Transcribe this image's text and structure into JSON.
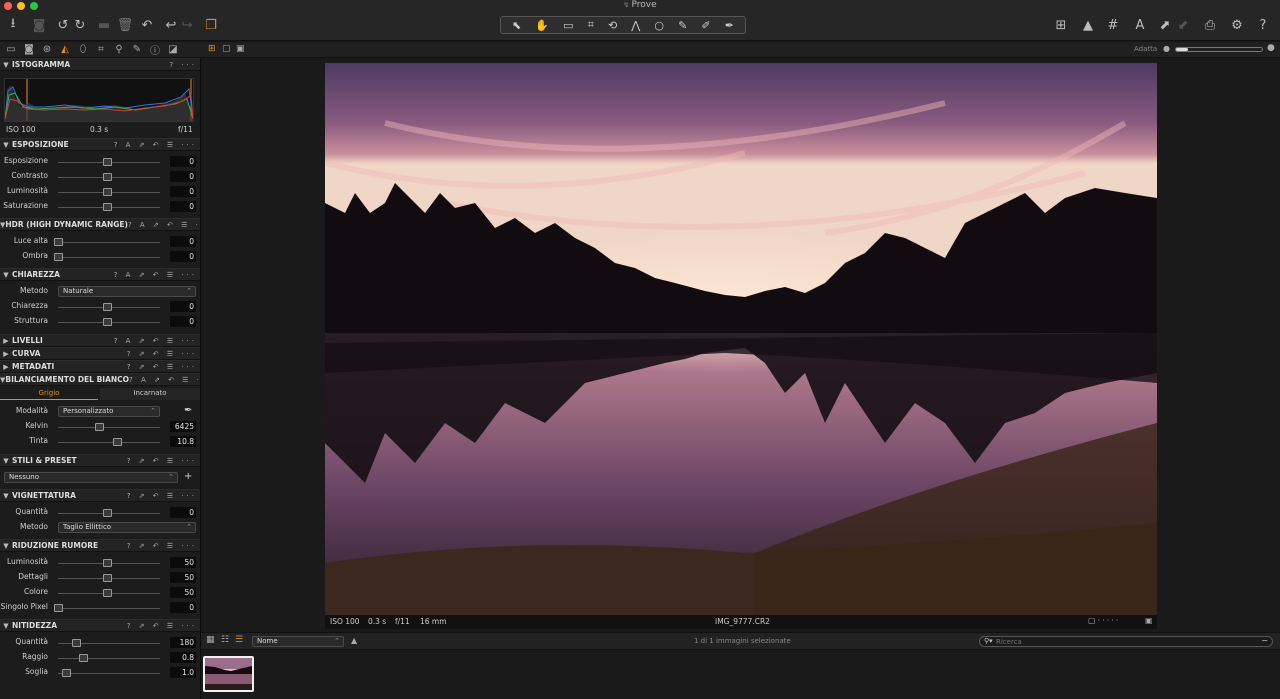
{
  "window": {
    "title": "Prove"
  },
  "colors": {
    "accent": "#e58a2b"
  },
  "histogram": {
    "iso": "ISO 100",
    "shutter": "0.3 s",
    "aperture": "f/11"
  },
  "sections": {
    "istogramma": "ISTOGRAMMA",
    "esposizione": "ESPOSIZIONE",
    "hdr": "HDR (HIGH DYNAMIC RANGE)",
    "chiarezza": "CHIAREZZA",
    "livelli": "LIVELLI",
    "curva": "CURVA",
    "metadati": "METADATI",
    "bilanciamento": "BILANCIAMENTO DEL BIANCO",
    "stili": "STILI & PRESET",
    "vignettatura": "VIGNETTATURA",
    "riduzione": "RIDUZIONE RUMORE",
    "nitidezza": "NITIDEZZA"
  },
  "esposizione": [
    {
      "label": "Esposizione",
      "value": "0",
      "pos": 0.5
    },
    {
      "label": "Contrasto",
      "value": "0",
      "pos": 0.5
    },
    {
      "label": "Luminosità",
      "value": "0",
      "pos": 0.5
    },
    {
      "label": "Saturazione",
      "value": "0",
      "pos": 0.5
    }
  ],
  "hdr": [
    {
      "label": "Luce alta",
      "value": "0",
      "pos": 0.0
    },
    {
      "label": "Ombra",
      "value": "0",
      "pos": 0.0
    }
  ],
  "chiarezza": {
    "metodo_label": "Metodo",
    "metodo_value": "Naturale",
    "sliders": [
      {
        "label": "Chiarezza",
        "value": "0",
        "pos": 0.5
      },
      {
        "label": "Struttura",
        "value": "0",
        "pos": 0.5
      }
    ]
  },
  "bilanciamento": {
    "tab_grigio": "Grigio",
    "tab_incarnato": "Incarnato",
    "modalita_label": "Modalità",
    "modalita_value": "Personalizzato",
    "sliders": [
      {
        "label": "Kelvin",
        "value": "6425",
        "pos": 0.42
      },
      {
        "label": "Tinta",
        "value": "10.8",
        "pos": 0.6
      }
    ]
  },
  "stili": {
    "value": "Nessuno"
  },
  "vignettatura": {
    "quantita_label": "Quantità",
    "quantita_value": "0",
    "quantita_pos": 0.5,
    "metodo_label": "Metodo",
    "metodo_value": "Taglio Ellittico"
  },
  "riduzione": [
    {
      "label": "Luminosità",
      "value": "50",
      "pos": 0.5
    },
    {
      "label": "Dettagli",
      "value": "50",
      "pos": 0.5
    },
    {
      "label": "Colore",
      "value": "50",
      "pos": 0.5
    },
    {
      "label": "Singolo Pixel",
      "value": "0",
      "pos": 0.0
    }
  ],
  "nitidezza": [
    {
      "label": "Quantità",
      "value": "180",
      "pos": 0.18
    },
    {
      "label": "Raggio",
      "value": "0.8",
      "pos": 0.26
    },
    {
      "label": "Soglia",
      "value": "1.0",
      "pos": 0.08
    }
  ],
  "viewer": {
    "fit_label": "Adatta",
    "iso": "ISO 100",
    "shutter": "0.3 s",
    "aperture": "f/11",
    "focal": "16 mm",
    "filename": "IMG_9777.CR2"
  },
  "browser": {
    "sort_value": "Nome",
    "status": "1 di 1 immagini selezionate",
    "search_placeholder": "Ricerca"
  }
}
